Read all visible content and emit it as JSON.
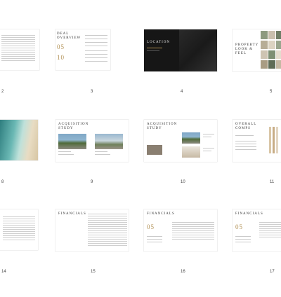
{
  "pages": [
    {
      "number": "2"
    },
    {
      "number": "3",
      "title_line1": "DEAL",
      "title_line2": "OVERVIEW",
      "big_number_1": "05",
      "big_number_2": "10"
    },
    {
      "number": "4",
      "title": "LOCATION"
    },
    {
      "number": "5",
      "title_line1": "PROPERTY",
      "title_line2": "LOOK &",
      "title_line3": "FEEL"
    },
    {
      "number": "8"
    },
    {
      "number": "9",
      "title_line1": "ACQUISITION",
      "title_line2": "STUDY"
    },
    {
      "number": "10",
      "title_line1": "ACQUISITION",
      "title_line2": "STUDY"
    },
    {
      "number": "11",
      "title_line1": "OVERALL",
      "title_line2": "COMPS"
    },
    {
      "number": "14"
    },
    {
      "number": "15",
      "title": "FINANCIALS"
    },
    {
      "number": "16",
      "title": "FINANCIALS",
      "big_number": "05"
    },
    {
      "number": "17",
      "title": "FINANCIALS",
      "big_number": "05"
    }
  ]
}
